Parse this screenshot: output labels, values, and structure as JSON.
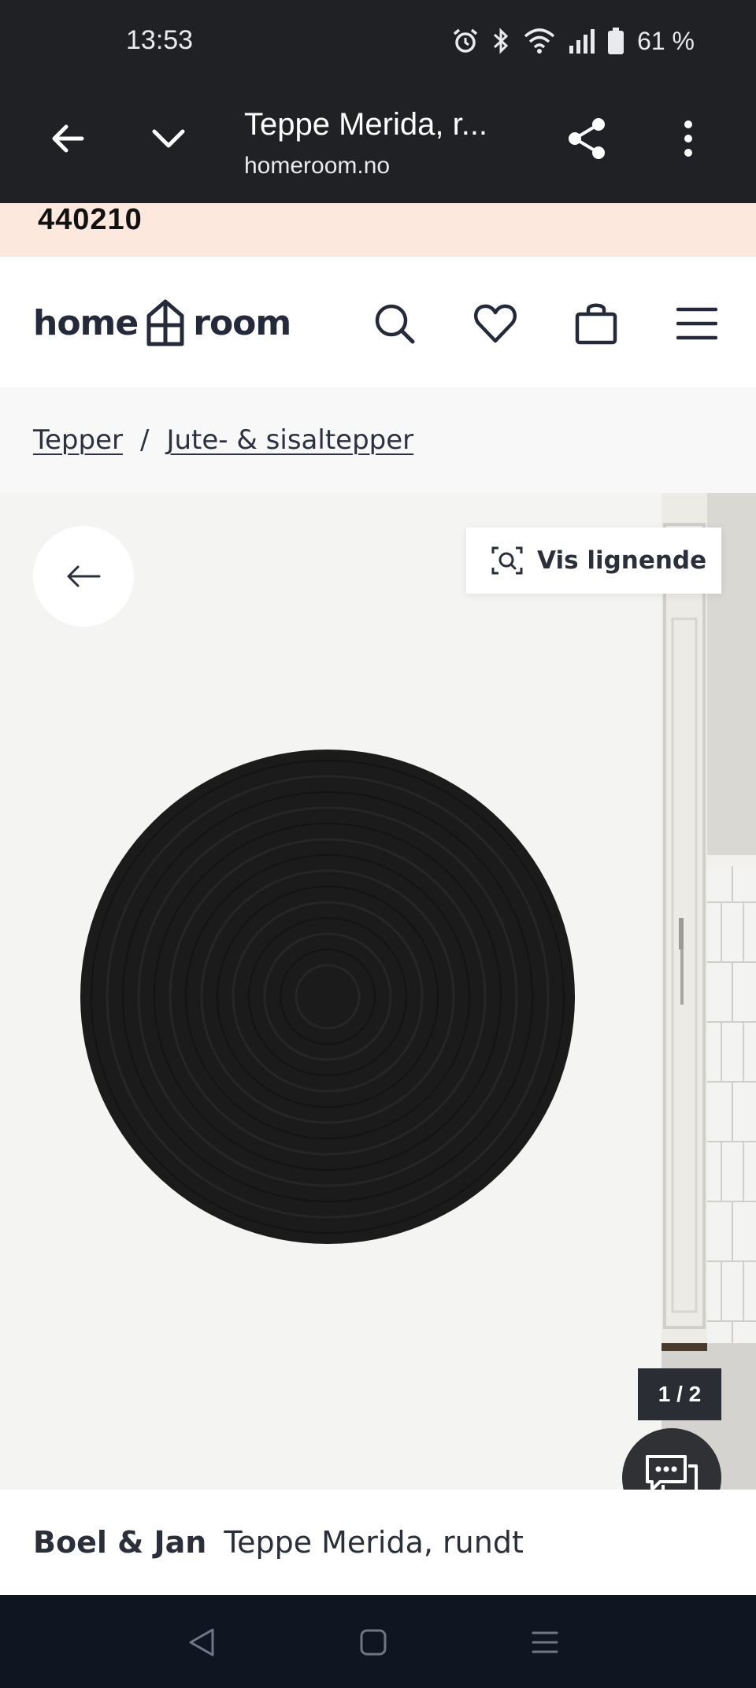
{
  "status_bar": {
    "time": "13:53",
    "battery": "61 %",
    "icons": [
      "alarm-icon",
      "bluetooth-icon",
      "wifi-icon",
      "signal-icon",
      "battery-icon"
    ]
  },
  "browser": {
    "title": "Teppe Merida, r...",
    "url": "homeroom.no",
    "buttons": [
      "back-arrow-icon",
      "tabs-chevron-icon",
      "share-icon",
      "more-vert-icon"
    ]
  },
  "promo": {
    "code": "440210"
  },
  "header": {
    "logo_left": "home",
    "logo_right": "room",
    "icons": [
      "search-icon",
      "heart-icon",
      "bag-icon",
      "hamburger-icon"
    ]
  },
  "breadcrumb": {
    "items": [
      "Tepper",
      "Jute- & sisaltepper"
    ],
    "separator": "/"
  },
  "gallery": {
    "similar_label": "Vis lignende",
    "counter": "1 / 2"
  },
  "product": {
    "brand": "Boel & Jan",
    "name": "Teppe Merida, rundt"
  },
  "colors": {
    "chrome": "#202124",
    "promo_bg": "#fde8dd",
    "text_dark": "#2b2f3a",
    "nav_bg": "#101522"
  }
}
